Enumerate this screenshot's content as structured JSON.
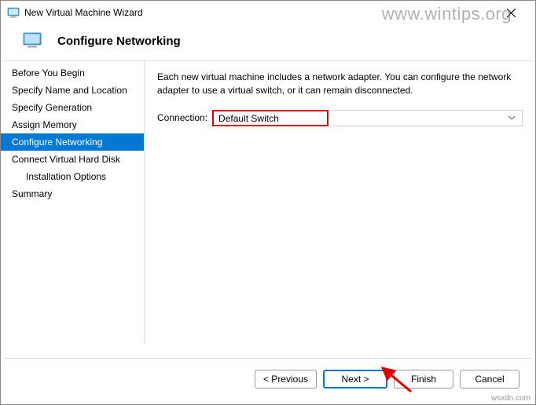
{
  "window": {
    "title": "New Virtual Machine Wizard"
  },
  "header": {
    "title": "Configure Networking"
  },
  "sidebar": {
    "items": [
      {
        "label": "Before You Begin",
        "active": false,
        "indent": false
      },
      {
        "label": "Specify Name and Location",
        "active": false,
        "indent": false
      },
      {
        "label": "Specify Generation",
        "active": false,
        "indent": false
      },
      {
        "label": "Assign Memory",
        "active": false,
        "indent": false
      },
      {
        "label": "Configure Networking",
        "active": true,
        "indent": false
      },
      {
        "label": "Connect Virtual Hard Disk",
        "active": false,
        "indent": false
      },
      {
        "label": "Installation Options",
        "active": false,
        "indent": true
      },
      {
        "label": "Summary",
        "active": false,
        "indent": false
      }
    ]
  },
  "main": {
    "description": "Each new virtual machine includes a network adapter. You can configure the network adapter to use a virtual switch, or it can remain disconnected.",
    "connection_label": "Connection:",
    "connection_value": "Default Switch"
  },
  "footer": {
    "previous": "< Previous",
    "next": "Next >",
    "finish": "Finish",
    "cancel": "Cancel"
  },
  "watermark": "www.wintips.org",
  "watermark2": "wsxdn.com"
}
